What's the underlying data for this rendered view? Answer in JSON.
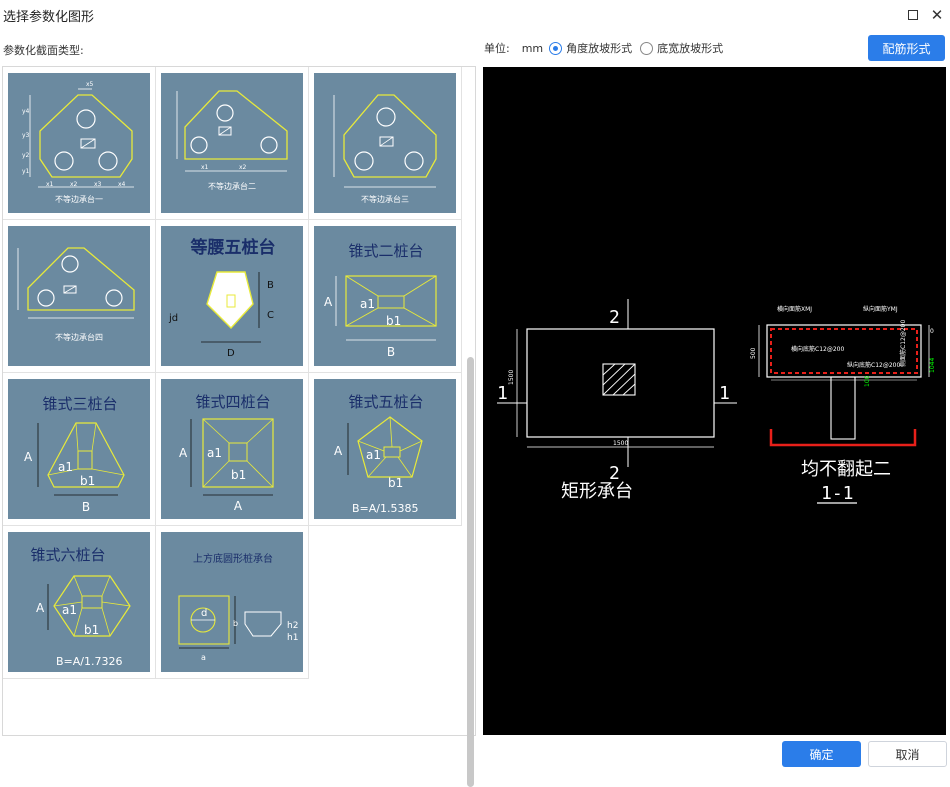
{
  "window": {
    "title": "选择参数化图形"
  },
  "left": {
    "label": "参数化截面类型:"
  },
  "unit": {
    "label": "单位:",
    "value": "mm"
  },
  "options": [
    {
      "label": "角度放坡形式",
      "selected": true
    },
    {
      "label": "底宽放坡形式",
      "selected": false
    }
  ],
  "buttons": {
    "rebar": "配筋形式",
    "ok": "确定",
    "cancel": "取消"
  },
  "shapes": [
    {
      "name": "不等边承台一",
      "label": "不等边承台一"
    },
    {
      "name": "不等边承台二",
      "label": "不等边承台二"
    },
    {
      "name": "不等边承台三",
      "label": "不等边承台三"
    },
    {
      "name": "不等边承台四",
      "label": "不等边承台四"
    },
    {
      "name": "等腰五桩台",
      "label": "等腰五桩台"
    },
    {
      "name": "锥式二桩台",
      "label": "锥式二桩台"
    },
    {
      "name": "锥式三桩台",
      "label": "锥式三桩台"
    },
    {
      "name": "锥式四桩台",
      "label": "锥式四桩台"
    },
    {
      "name": "锥式五桩台",
      "label": "锥式五桩台"
    },
    {
      "name": "锥式六桩台",
      "label": "锥式六桩台"
    },
    {
      "name": "上方底圆形桩承台",
      "label": "上方底圆形桩承台"
    }
  ],
  "shape_extras": {
    "x_labels": [
      "x1",
      "x2",
      "x3",
      "x4",
      "x5"
    ],
    "y_labels": [
      "y1",
      "y2",
      "y3",
      "y4"
    ],
    "a1": "a1",
    "b1": "b1",
    "A": "A",
    "B": "B",
    "C": "C",
    "D": "D",
    "jd": "jd",
    "d": "d",
    "a": "a",
    "b": "b",
    "h1": "h1",
    "h2": "h2",
    "note5": "B=A/1.5385",
    "note6": "B=A/1.7326"
  },
  "preview": {
    "shape_name": "矩形承台",
    "dim_w": "1500",
    "dim_h": "1500",
    "dim_depth": "500",
    "dim_right": "1044",
    "sec_mark_top": "2",
    "sec_mark_bottom": "2",
    "sec_mark_left": "1",
    "sec_mark_right": "1",
    "section_title": "均不翻起二",
    "section_id": "1-1",
    "rebar_top_x": "横向面筋XMJ",
    "rebar_top_y": "纵向面筋YMJ",
    "rebar_bot_x": "横向底筋C12@200",
    "rebar_bot_y": "纵向底筋C12@200",
    "rebar_side": "侧面筋C12@200",
    "side_tag": "100",
    "right_tag": "0"
  }
}
